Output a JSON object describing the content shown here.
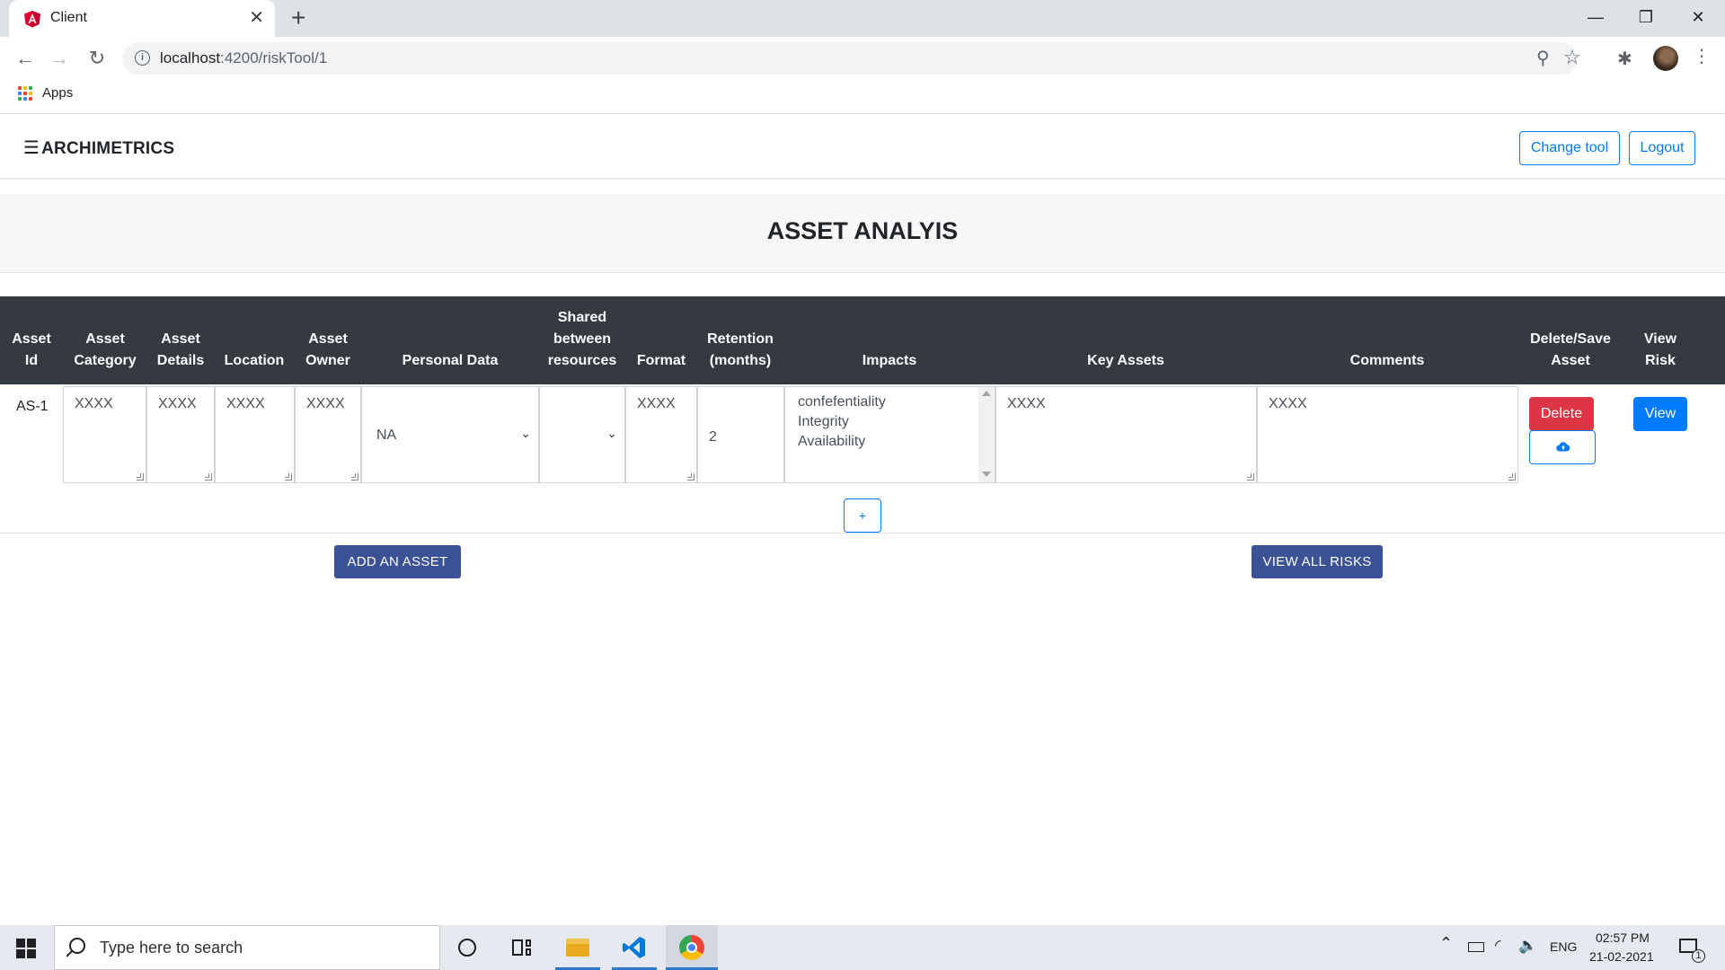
{
  "browser": {
    "tab_title": "Client",
    "url_host": "localhost",
    "url_path": ":4200/riskTool/1",
    "bookmarks_apps_label": "Apps",
    "colors": {
      "angular_red": "#dd0031"
    }
  },
  "app": {
    "brand": "ARCHIMETRICS",
    "change_tool_label": "Change tool",
    "logout_label": "Logout",
    "page_title": "ASSET ANALYIS"
  },
  "table": {
    "headers": {
      "asset_id": [
        "Asset",
        "Id"
      ],
      "asset_category": [
        "Asset",
        "Category"
      ],
      "asset_details": [
        "Asset",
        "Details"
      ],
      "location": "Location",
      "asset_owner": [
        "Asset",
        "Owner"
      ],
      "personal_data": "Personal Data",
      "shared": [
        "Shared",
        "between",
        "resources"
      ],
      "format": "Format",
      "retention": [
        "Retention",
        "(months)"
      ],
      "impacts": "Impacts",
      "key_assets": "Key Assets",
      "comments": "Comments",
      "delete_save": [
        "Delete/Save",
        "Asset"
      ],
      "view_risk": [
        "View",
        "Risk"
      ]
    },
    "rows": [
      {
        "asset_id": "AS-1",
        "asset_category": "XXXX",
        "asset_details": "XXXX",
        "location": "XXXX",
        "asset_owner": "XXXX",
        "personal_data": "NA",
        "shared": "",
        "format": "XXXX",
        "retention": "2",
        "impacts": [
          "confefentiality",
          "Integrity",
          "Availability"
        ],
        "key_assets": "XXXX",
        "comments": "XXXX",
        "delete_label": "Delete",
        "view_label": "View"
      }
    ],
    "add_row_label": "+"
  },
  "actions": {
    "add_asset_label": "ADD AN ASSET",
    "view_all_risks_label": "VIEW ALL RISKS"
  },
  "taskbar": {
    "search_placeholder": "Type here to search",
    "language": "ENG",
    "time": "02:57 PM",
    "date": "21-02-2021",
    "notification_count": "1"
  }
}
